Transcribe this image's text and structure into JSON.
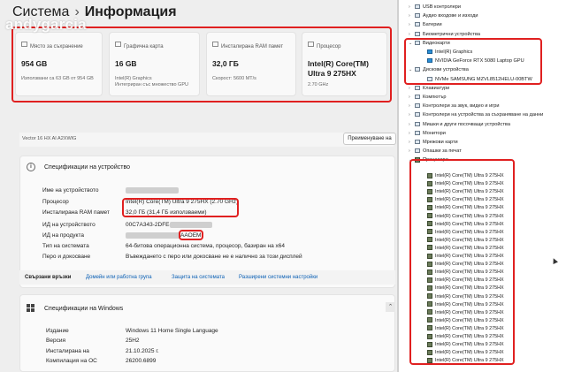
{
  "watermark": "andygarcia",
  "header": {
    "crumb1": "Система",
    "sep": "›",
    "crumb2": "Информация"
  },
  "cards": [
    {
      "title": "Място за съхранение",
      "value": "954 GB",
      "sub": "Използвани са 63 GB от 954 GB"
    },
    {
      "title": "Графична карта",
      "value": "16 GB",
      "sub": "Intel(R) Graphics\nИнтегриран със множество GPU"
    },
    {
      "title": "Инсталирана RAM памет",
      "value": "32,0 ГБ",
      "sub": "Скорост: 5600 MT/s"
    },
    {
      "title": "Процесор",
      "value": "Intel(R) Core(TM) Ultra 9 275HX",
      "sub": "2.70 GHz"
    }
  ],
  "hostname": "Vector 16 HX AI A2XWIG",
  "rename_button": "Преименуване на",
  "specs": {
    "title": "Спецификации на устройство",
    "rows": [
      {
        "label": "Име на устройството",
        "value": ""
      },
      {
        "label": "Процесор",
        "value": "Intel(R) Core(TM) Ultra 9 275HX (2.70 GHz)"
      },
      {
        "label": "Инсталирана RAM памет",
        "value": "32,0 ГБ (31,4 ГБ използваеми)"
      },
      {
        "label": "ИД на устройството",
        "value": "00C7A343-2DFE-"
      },
      {
        "label": "ИД на продукта",
        "value": "AAOEM"
      },
      {
        "label": "Тип на системата",
        "value": "64-битова операционна система, процесор, базиран на x64"
      },
      {
        "label": "Перо и докосване",
        "value": "Въвеждането с перо или докосване не е налично за този дисплей"
      }
    ]
  },
  "related_links": [
    "Свързани връзки",
    "Домейн или работна група",
    "Защита на системата",
    "Разширени системни настройки"
  ],
  "windows": {
    "title": "Спецификации на Windows",
    "rows": [
      {
        "label": "Издание",
        "value": "Windows 11 Home Single Language"
      },
      {
        "label": "Версия",
        "value": "25H2"
      },
      {
        "label": "Инсталирана на",
        "value": "21.10.2025 г."
      },
      {
        "label": "Компилация на ОС",
        "value": "26200.6899"
      }
    ]
  },
  "device_tree": [
    {
      "chev": "›",
      "label": "USB контролери",
      "indent": 0,
      "icon": "usb-icon"
    },
    {
      "chev": "›",
      "label": "Аудио входове и изходи",
      "indent": 0,
      "icon": "audio-icon"
    },
    {
      "chev": "›",
      "label": "Батерии",
      "indent": 0,
      "icon": "battery-icon"
    },
    {
      "chev": "›",
      "label": "Биометрични устройства",
      "indent": 0,
      "icon": "biometric-icon"
    },
    {
      "chev": "⌄",
      "label": "Видеокарти",
      "indent": 0,
      "icon": "display-adapter-icon"
    },
    {
      "chev": "",
      "label": "Intel(R) Graphics",
      "indent": 1,
      "icon": "gpu-icon"
    },
    {
      "chev": "",
      "label": "NVIDIA GeForce RTX 5080 Laptop GPU",
      "indent": 1,
      "icon": "gpu-icon"
    },
    {
      "chev": "⌄",
      "label": "Дискови устройства",
      "indent": 0,
      "icon": "disk-icon"
    },
    {
      "chev": "",
      "label": "NVMe SAMSUNG MZVL8512HELU-00BTW",
      "indent": 1,
      "icon": "disk-icon"
    },
    {
      "chev": "›",
      "label": "Клавиатури",
      "indent": 0,
      "icon": "keyboard-icon"
    },
    {
      "chev": "›",
      "label": "Компютър",
      "indent": 0,
      "icon": "computer-icon"
    },
    {
      "chev": "›",
      "label": "Контролери за звук, видео и игри",
      "indent": 0,
      "icon": "sound-icon"
    },
    {
      "chev": "›",
      "label": "Контролери на устройства за съхраняване на данни",
      "indent": 0,
      "icon": "storage-controller-icon"
    },
    {
      "chev": "›",
      "label": "Мишки и други посочващи устройства",
      "indent": 0,
      "icon": "mouse-icon"
    },
    {
      "chev": "›",
      "label": "Монитори",
      "indent": 0,
      "icon": "monitor-icon"
    },
    {
      "chev": "›",
      "label": "Мрежови карти",
      "indent": 0,
      "icon": "network-icon"
    },
    {
      "chev": "›",
      "label": "Опашки за печат",
      "indent": 0,
      "icon": "printer-icon"
    },
    {
      "chev": "⌄",
      "label": "Процесори",
      "indent": 0,
      "icon": "cpu-icon"
    }
  ],
  "cpu_item": "Intel(R) Core(TM) Ultra 9 275HX",
  "cpu_count": 24
}
